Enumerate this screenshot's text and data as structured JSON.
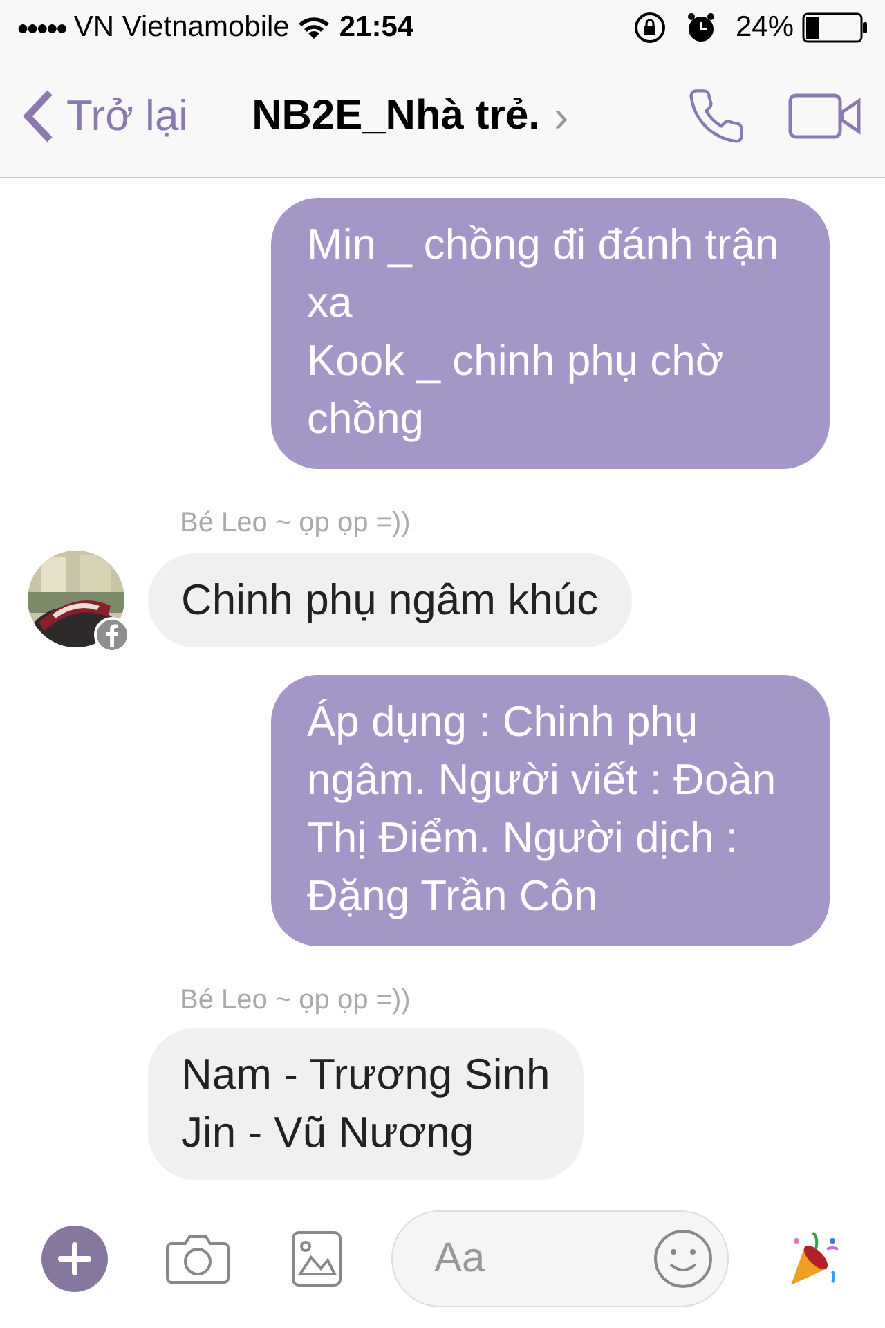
{
  "status_bar": {
    "signal": "●●●●●",
    "carrier": "VN Vietnamobile",
    "time": "21:54",
    "battery": "24%"
  },
  "header": {
    "back": "Trở lại",
    "title": "NB2E_Nhà trẻ.",
    "chevron": "›"
  },
  "messages": [
    {
      "kind": "sent",
      "text": "Min _ chồng đi đánh trận xa\nKook _ chinh phụ chờ chồng"
    },
    {
      "kind": "received",
      "sender": "Bé Leo ~ ọp ọp =))",
      "text": "Chinh phụ ngâm khúc",
      "avatar": true
    },
    {
      "kind": "sent",
      "text": "Áp dụng : Chinh phụ ngâm. Người viết : Đoàn Thị Điểm. Người dịch : Đặng Trần Côn"
    },
    {
      "kind": "received",
      "sender": "Bé Leo ~ ọp ọp =))",
      "text": "Nam - Trương Sinh\nJin - Vũ Nương",
      "avatar": false
    }
  ],
  "composer": {
    "placeholder": "Aa"
  }
}
